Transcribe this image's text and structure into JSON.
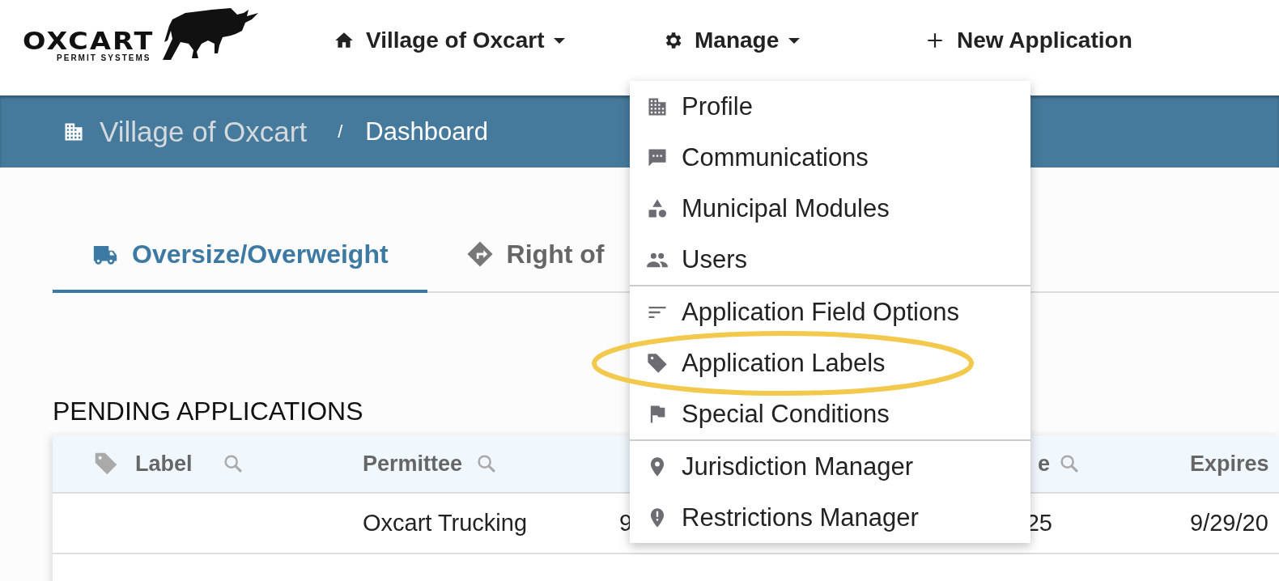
{
  "logo": {
    "name": "OXCART",
    "tagline": "PERMIT SYSTEMS"
  },
  "nav": [
    {
      "label": "Village of Oxcart",
      "dropdown": true
    },
    {
      "label": "Manage",
      "dropdown": true
    },
    {
      "label": "New Application",
      "dropdown": false
    }
  ],
  "breadcrumb": {
    "items": [
      "Village of Oxcart",
      "Dashboard"
    ],
    "separator": "/"
  },
  "tabs": [
    {
      "label": "Oversize/Overweight",
      "selected": true
    },
    {
      "label": "Right of",
      "selected": false
    }
  ],
  "section_title": "PENDING APPLICATIONS",
  "table": {
    "columns": [
      {
        "label": "Label",
        "search": true
      },
      {
        "label": "Permittee",
        "search": true
      },
      {
        "search": false
      },
      {
        "label": "e",
        "search": true
      },
      {
        "label": "Expires",
        "search": false
      }
    ],
    "rows": [
      [
        "",
        "Oxcart Trucking",
        "9",
        "25",
        "9/29/20"
      ]
    ]
  },
  "menu": {
    "groups": [
      [
        {
          "label": "Profile",
          "highlighted": false
        },
        {
          "label": "Communications",
          "highlighted": false
        },
        {
          "label": "Municipal Modules",
          "highlighted": false
        },
        {
          "label": "Users",
          "highlighted": false
        }
      ],
      [
        {
          "label": "Application Field Options",
          "highlighted": false
        },
        {
          "label": "Application Labels",
          "highlighted": true
        },
        {
          "label": "Special Conditions",
          "highlighted": false
        }
      ],
      [
        {
          "label": "Jurisdiction Manager",
          "highlighted": false
        },
        {
          "label": "Restrictions Manager",
          "highlighted": false
        }
      ]
    ]
  }
}
